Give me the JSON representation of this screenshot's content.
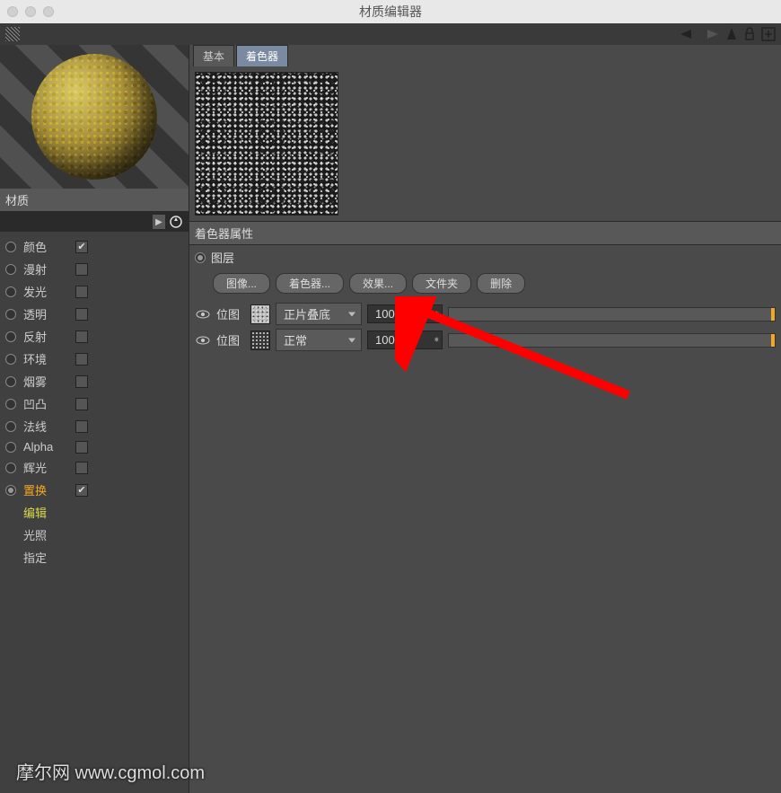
{
  "window": {
    "title": "材质编辑器"
  },
  "sidebar": {
    "material_label": "材质",
    "channels": [
      {
        "label": "颜色",
        "checked": true
      },
      {
        "label": "漫射",
        "checked": false
      },
      {
        "label": "发光",
        "checked": false
      },
      {
        "label": "透明",
        "checked": false
      },
      {
        "label": "反射",
        "checked": false
      },
      {
        "label": "环境",
        "checked": false
      },
      {
        "label": "烟雾",
        "checked": false
      },
      {
        "label": "凹凸",
        "checked": false
      },
      {
        "label": "法线",
        "checked": false
      },
      {
        "label": "Alpha",
        "checked": false
      },
      {
        "label": "辉光",
        "checked": false
      },
      {
        "label": "置换",
        "checked": true,
        "active": true
      }
    ],
    "subitems": [
      "编辑",
      "光照",
      "指定"
    ]
  },
  "tabs": {
    "basic": "基本",
    "shader": "着色器"
  },
  "shader": {
    "header": "着色器属性",
    "layer_label": "图层",
    "buttons": {
      "image": "图像...",
      "shader": "着色器...",
      "effect": "效果...",
      "folder": "文件夹",
      "delete": "删除"
    },
    "layers": [
      {
        "name": "位图",
        "blend": "正片叠底",
        "opacity": "100 %"
      },
      {
        "name": "位图",
        "blend": "正常",
        "opacity": "100 %"
      }
    ]
  },
  "watermark": "摩尔网 www.cgmol.com"
}
